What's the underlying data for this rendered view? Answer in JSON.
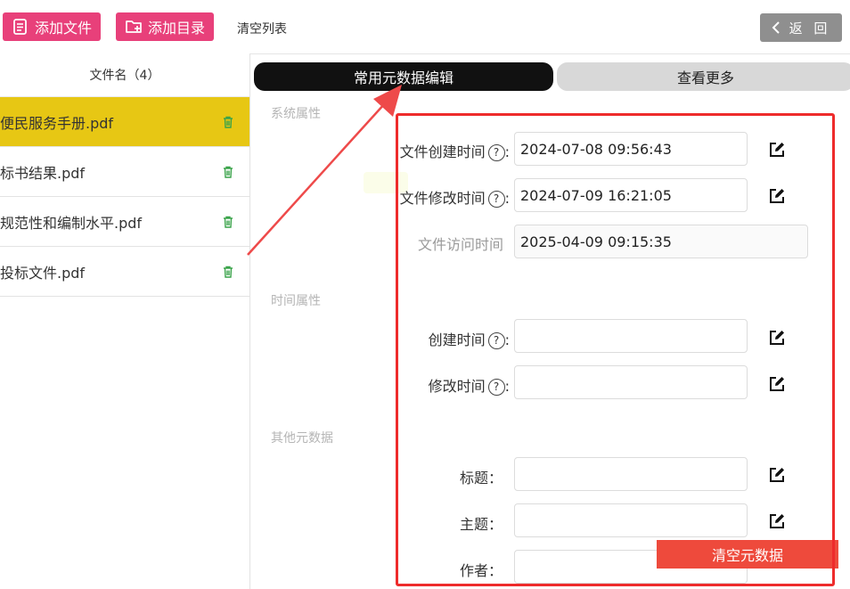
{
  "toolbar": {
    "add_file": "添加文件",
    "add_dir": "添加目录",
    "clear_list": "清空列表",
    "back": "返 回"
  },
  "file_list": {
    "header": "文件名（4）",
    "items": [
      {
        "name": "便民服务手册.pdf",
        "selected": true
      },
      {
        "name": "标书结果.pdf",
        "selected": false
      },
      {
        "name": "规范性和编制水平.pdf",
        "selected": false
      },
      {
        "name": "投标文件.pdf",
        "selected": false
      }
    ]
  },
  "tabs": {
    "common": "常用元数据编辑",
    "more": "查看更多"
  },
  "sections": {
    "system": "系统属性",
    "time": "时间属性",
    "other": "其他元数据"
  },
  "fields": {
    "created": {
      "label": "文件创建时间",
      "value": "2024-07-08 09:56:43"
    },
    "modified": {
      "label": "文件修改时间",
      "value": "2024-07-09 16:21:05"
    },
    "accessed": {
      "label": "文件访问时间",
      "value": "2025-04-09 09:15:35"
    },
    "create_time": {
      "label": "创建时间",
      "value": ""
    },
    "modify_time": {
      "label": "修改时间",
      "value": ""
    },
    "title": {
      "label": "标题：",
      "value": ""
    },
    "subject": {
      "label": "主题：",
      "value": ""
    },
    "author": {
      "label": "作者：",
      "value": ""
    }
  },
  "help_glyph": "?",
  "colon": ":",
  "clear_metadata": "清空元数据",
  "colors": {
    "pink_button": "#e8407a",
    "selected_row": "#e7c714",
    "highlight_red": "#ee2b2b",
    "clear_button": "#ee4a3c"
  }
}
